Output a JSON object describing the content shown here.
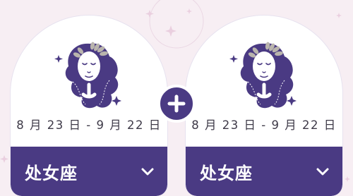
{
  "colors": {
    "background": "#f7eef3",
    "accent": "#4a3a83",
    "card": "#ffffff",
    "date_text": "#3e3a48"
  },
  "compatibility": {
    "first_sign": {
      "icon": "virgo-icon",
      "date_range": "8 月 23 日 - 9 月 22 日",
      "selected_sign": "处女座"
    },
    "second_sign": {
      "icon": "virgo-icon",
      "date_range": "8 月 23 日 - 9 月 22 日",
      "selected_sign": "处女座"
    },
    "combine_icon": "plus-icon",
    "dropdown_icon": "chevron-down-icon"
  }
}
